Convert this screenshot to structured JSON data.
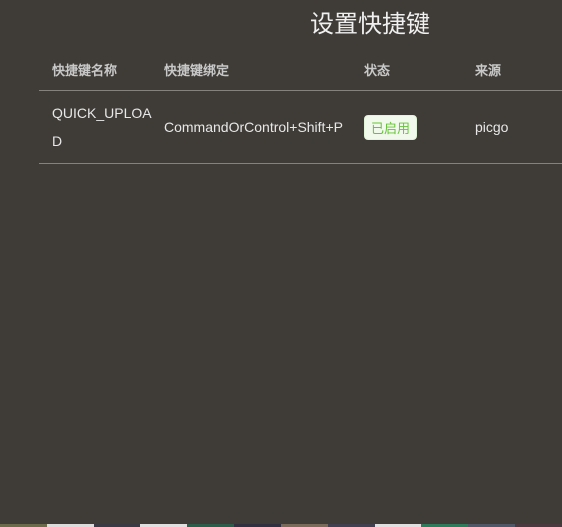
{
  "page": {
    "title": "设置快捷键"
  },
  "table": {
    "headers": [
      "快捷键名称",
      "快捷键绑定",
      "状态",
      "来源"
    ],
    "rows": [
      {
        "name": "QUICK_UPLOAD",
        "binding": "CommandOrControl+Shift+P",
        "status": "已启用",
        "source": "picgo"
      }
    ]
  },
  "colors": {
    "background": "#3f3c37",
    "status_enabled": "#67c23a"
  }
}
